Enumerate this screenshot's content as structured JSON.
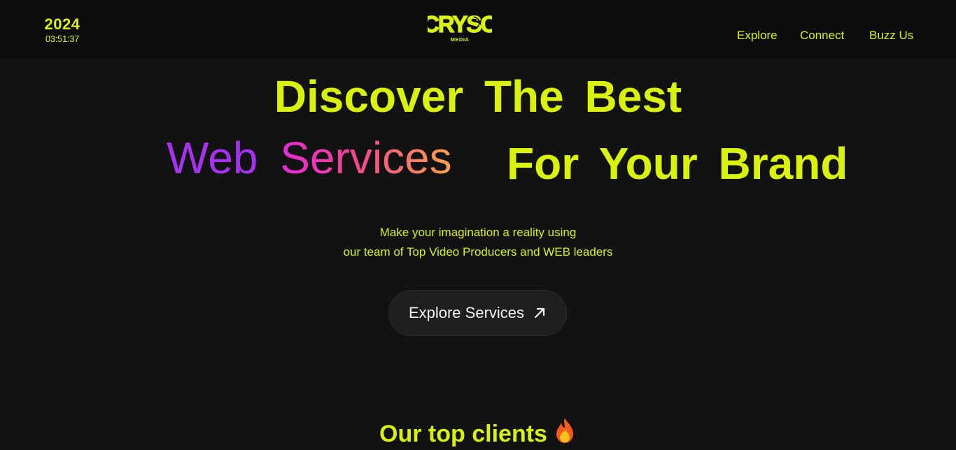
{
  "header": {
    "year": "2024",
    "time": "03:51:37",
    "logo_text": "CRYSO",
    "logo_subtext": "MEDIA",
    "nav": [
      {
        "label": "Explore"
      },
      {
        "label": "Connect"
      },
      {
        "label": "Buzz Us"
      }
    ]
  },
  "hero": {
    "line1": "Discover The Best",
    "web": "Web",
    "services": "Services",
    "line2_end": "For Your Brand",
    "tagline_1": "Make your imagination a reality using",
    "tagline_2": "our team of Top Video Producers and WEB leaders",
    "cta_label": "Explore Services",
    "cta_icon": "arrow-up-right-icon"
  },
  "clients": {
    "title": "Our top clients",
    "icon": "fire-icon"
  },
  "colors": {
    "background": "#121212",
    "header_background": "#0c0c0c",
    "accent": "#d9f20b",
    "gradient_purple": "#a632f0",
    "gradient_pink": "#e42ad8",
    "gradient_orange": "#f9a14b",
    "button_background": "#1f1f1f"
  }
}
